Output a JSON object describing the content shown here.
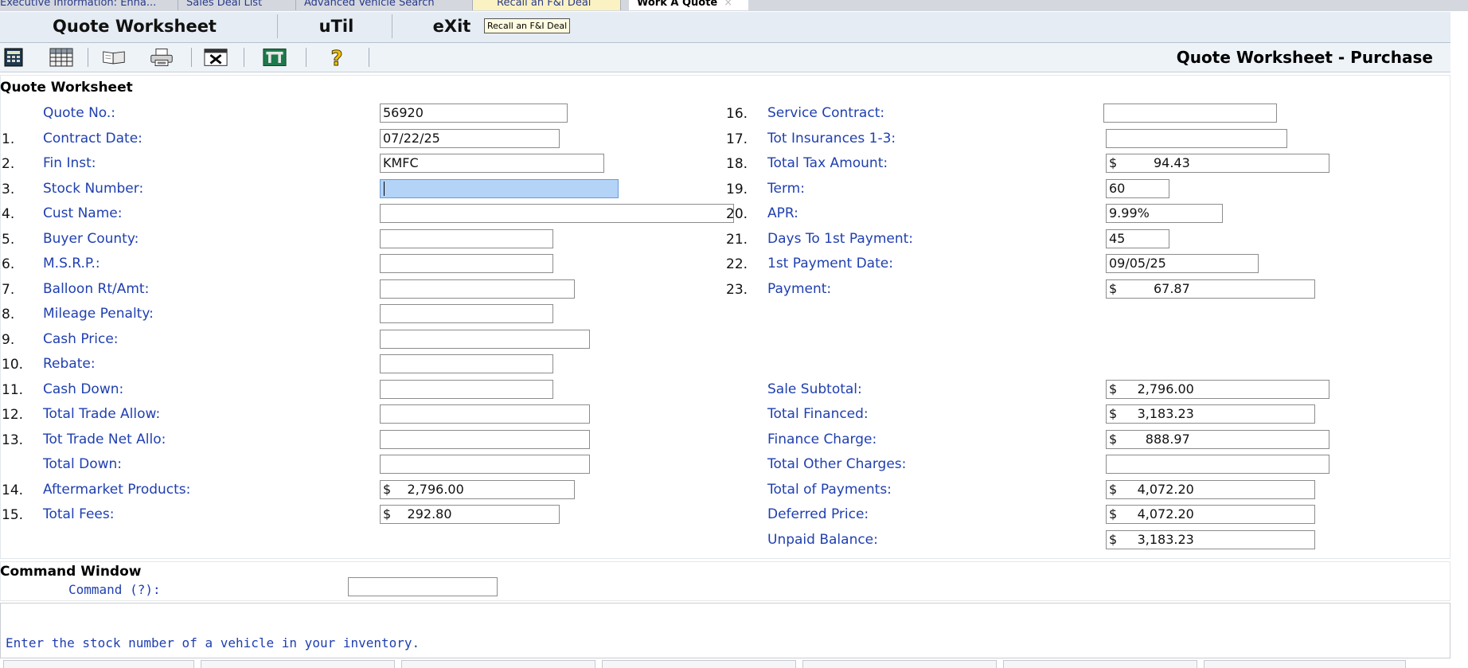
{
  "tabs": [
    {
      "label": "Executive  Information:  Enha..."
    },
    {
      "label": "Sales Deal List"
    },
    {
      "label": "Advanced Vehicle Search"
    },
    {
      "label": "Recall an F&I Deal"
    },
    {
      "label": "Work A Quote",
      "close": "×"
    }
  ],
  "menu": {
    "items": [
      "Quote Worksheet",
      "uTil",
      "eXit"
    ],
    "tooltip": "Recall an F&I Deal"
  },
  "toolbar": {
    "icons": [
      "calculator-icon",
      "spreadsheet-icon",
      "book-icon",
      "printer-icon",
      "close-window-icon",
      "tools-icon",
      "help-icon"
    ],
    "page_heading": "Quote Worksheet - Purchase"
  },
  "form": {
    "title": "Quote Worksheet",
    "left": [
      {
        "num": "",
        "label": "Quote No.:",
        "value": "56920"
      },
      {
        "num": "1.",
        "label": "Contract Date:",
        "value": "07/22/25"
      },
      {
        "num": "2.",
        "label": "Fin Inst:",
        "value": "KMFC"
      },
      {
        "num": "3.",
        "label": "Stock Number:",
        "value": ""
      },
      {
        "num": "4.",
        "label": "Cust Name:",
        "value": ""
      },
      {
        "num": "5.",
        "label": "Buyer County:",
        "value": ""
      },
      {
        "num": "6.",
        "label": "M.S.R.P.:",
        "value": ""
      },
      {
        "num": "7.",
        "label": "Balloon Rt/Amt:",
        "value": ""
      },
      {
        "num": "8.",
        "label": "Mileage Penalty:",
        "value": ""
      },
      {
        "num": "9.",
        "label": "Cash Price:",
        "value": ""
      },
      {
        "num": "10.",
        "label": "Rebate:",
        "value": ""
      },
      {
        "num": "11.",
        "label": "Cash Down:",
        "value": ""
      },
      {
        "num": "12.",
        "label": "Total Trade Allow:",
        "value": ""
      },
      {
        "num": "13.",
        "label": "Tot Trade Net Allo:",
        "value": ""
      },
      {
        "num": "",
        "label": "Total Down:",
        "value": ""
      },
      {
        "num": "14.",
        "label": "Aftermarket Products:",
        "value": "$    2,796.00"
      },
      {
        "num": "15.",
        "label": "Total Fees:",
        "value": "$    292.80"
      }
    ],
    "right": [
      {
        "num": "16.",
        "label": "Service Contract:",
        "value": ""
      },
      {
        "num": "17.",
        "label": "Tot Insurances 1-3:",
        "value": ""
      },
      {
        "num": "18.",
        "label": "Total Tax Amount:",
        "value": "$         94.43"
      },
      {
        "num": "19.",
        "label": "Term:",
        "value": "60"
      },
      {
        "num": "20.",
        "label": "APR:",
        "value": "9.99%"
      },
      {
        "num": "21.",
        "label": "Days To 1st Payment:",
        "value": "45"
      },
      {
        "num": "22.",
        "label": "1st Payment Date:",
        "value": "09/05/25"
      },
      {
        "num": "23.",
        "label": "Payment:",
        "value": "$         67.87"
      }
    ],
    "totals": [
      {
        "label": "Sale Subtotal:",
        "value": "$     2,796.00"
      },
      {
        "label": "Total Financed:",
        "value": "$     3,183.23"
      },
      {
        "label": "Finance Charge:",
        "value": "$       888.97"
      },
      {
        "label": "Total Other Charges:",
        "value": ""
      },
      {
        "label": "Total of Payments:",
        "value": "$     4,072.20"
      },
      {
        "label": "Deferred Price:",
        "value": "$     4,072.20"
      },
      {
        "label": "Unpaid Balance:",
        "value": "$     3,183.23"
      }
    ]
  },
  "command": {
    "title": "Command Window",
    "label": "Command (?):",
    "value": ""
  },
  "status": {
    "message": "Enter the stock number of a vehicle in your inventory."
  },
  "colors": {
    "label": "#1f3fb0",
    "focus_field": "#b3d3f7",
    "menubar": "#e5ecf3"
  }
}
